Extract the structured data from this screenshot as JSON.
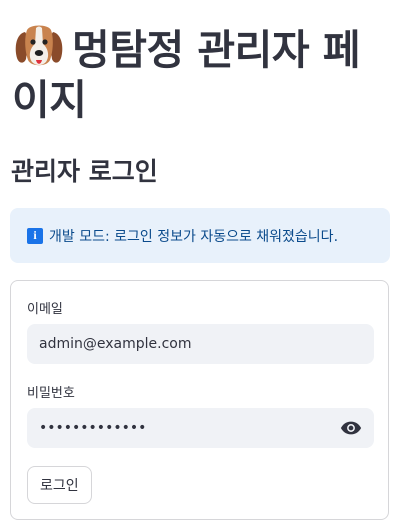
{
  "header": {
    "title": "멍탐정 관리자 페이지",
    "logo_icon": "beagle-dog-face-icon"
  },
  "section": {
    "title": "관리자 로그인"
  },
  "alert": {
    "icon": "info-icon",
    "icon_glyph": "i",
    "message": "개발 모드: 로그인 정보가 자동으로 채워졌습니다.",
    "background": "#e8f1fb",
    "text_color": "#0b4b8c"
  },
  "login_form": {
    "email_label": "이메일",
    "email_value": "admin@example.com",
    "password_label": "비밀번호",
    "password_masked": "•••••••••••••",
    "show_password_icon": "eye-icon",
    "submit_label": "로그인"
  }
}
